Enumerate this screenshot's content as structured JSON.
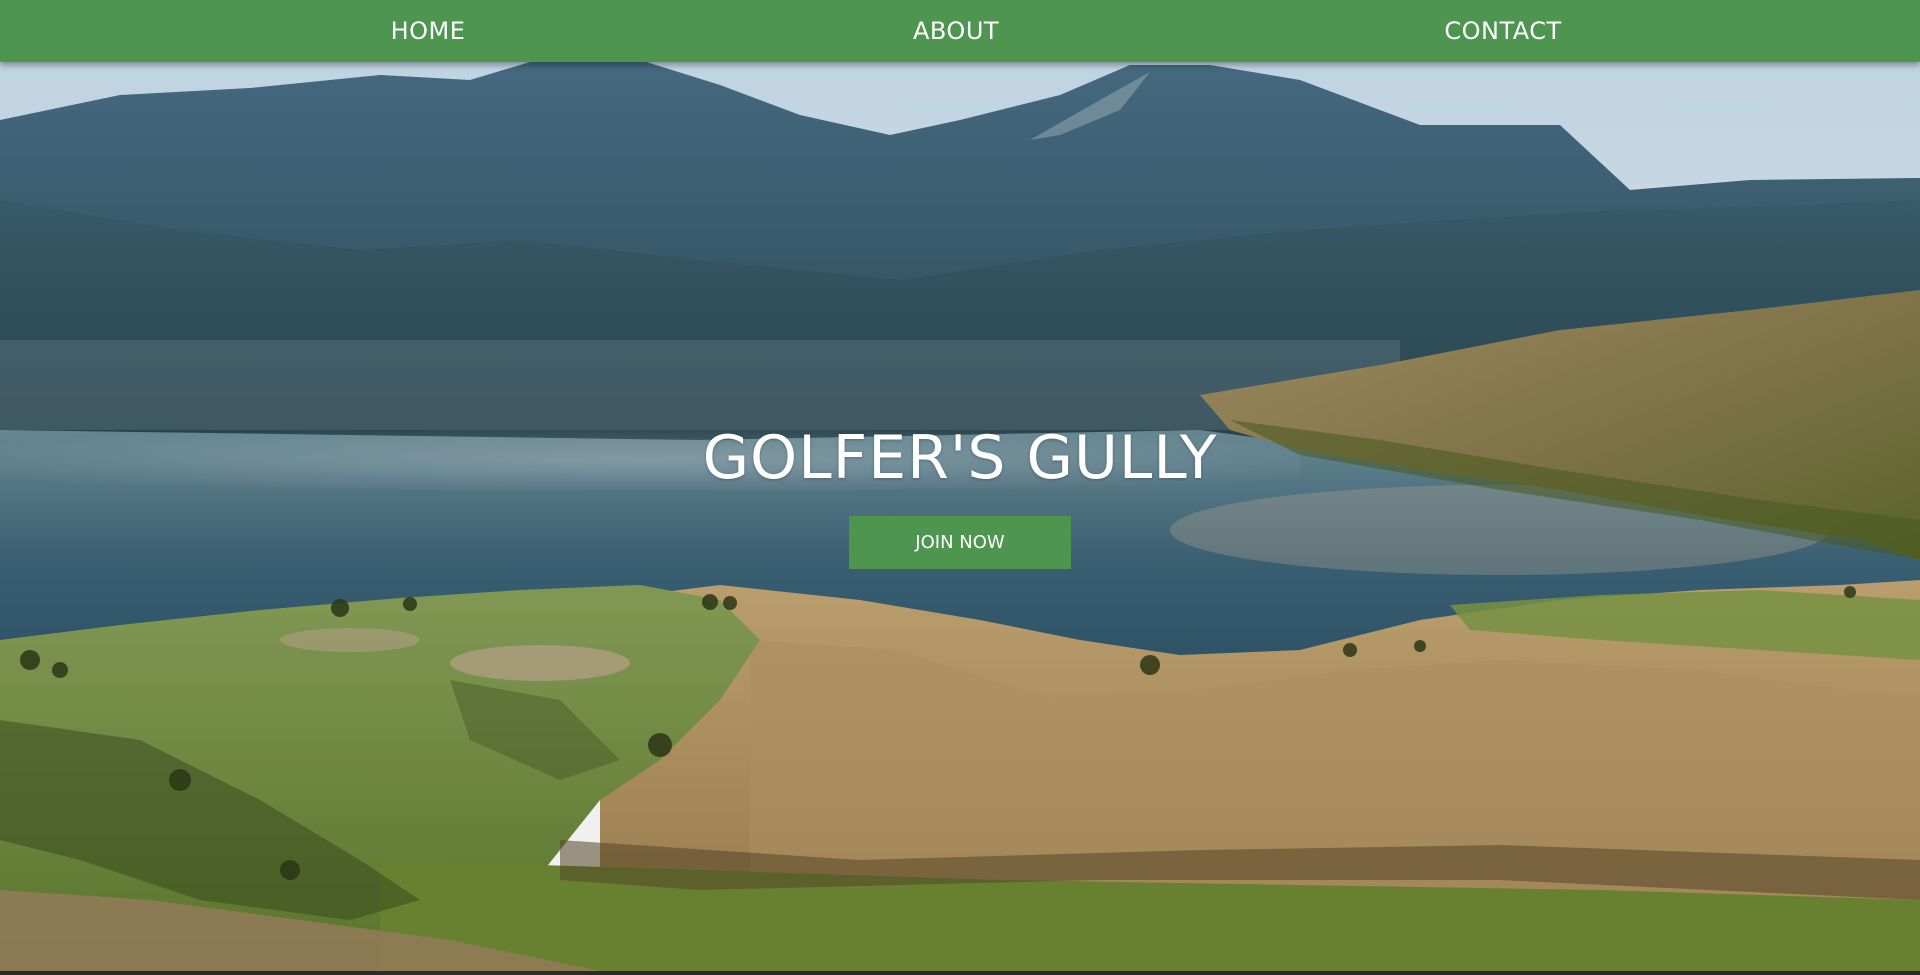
{
  "nav": {
    "items": [
      {
        "label": "HOME"
      },
      {
        "label": "ABOUT"
      },
      {
        "label": "CONTACT"
      }
    ]
  },
  "hero": {
    "title": "GOLFER'S GULLY",
    "cta_label": "JOIN NOW",
    "background": "golf-course-landscape-image"
  },
  "colors": {
    "nav_background": "#4e9650",
    "cta_background": "#4e9650",
    "text": "#ffffff"
  }
}
